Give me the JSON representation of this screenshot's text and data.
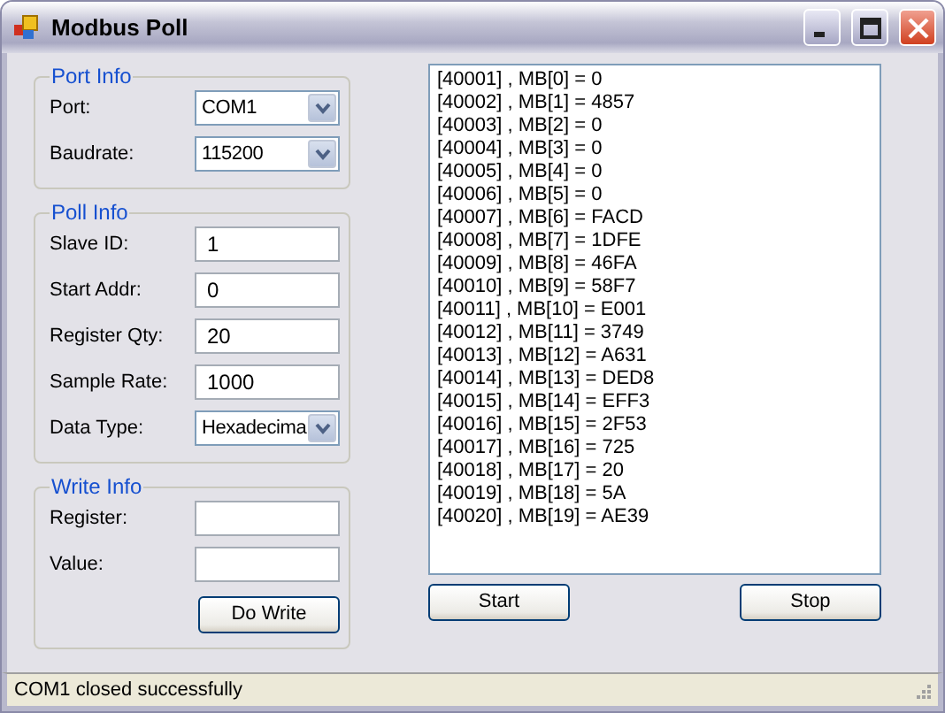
{
  "window": {
    "title": "Modbus Poll"
  },
  "groups": [
    {
      "title": "Port Info",
      "fields": [
        {
          "label": "Port:",
          "kind": "dropdown",
          "value": "COM1"
        },
        {
          "label": "Baudrate:",
          "kind": "dropdown",
          "value": "115200"
        }
      ]
    },
    {
      "title": "Poll Info",
      "fields": [
        {
          "label": "Slave ID:",
          "kind": "text",
          "value": "1"
        },
        {
          "label": "Start Addr:",
          "kind": "text",
          "value": "0"
        },
        {
          "label": "Register Qty:",
          "kind": "text",
          "value": "20"
        },
        {
          "label": "Sample Rate:",
          "kind": "text",
          "value": "1000"
        },
        {
          "label": "Data Type:",
          "kind": "dropdown",
          "value": "Hexadecima"
        }
      ]
    },
    {
      "title": "Write Info",
      "fields": [
        {
          "label": "Register:",
          "kind": "text"
        },
        {
          "label": "Value:",
          "kind": "text"
        }
      ],
      "button": "Do Write"
    }
  ],
  "registers": [
    "[40001] , MB[0] = 0",
    "[40002] , MB[1] = 4857",
    "[40003] , MB[2] = 0",
    "[40004] , MB[3] = 0",
    "[40005] , MB[4] = 0",
    "[40006] , MB[5] = 0",
    "[40007] , MB[6] = FACD",
    "[40008] , MB[7] = 1DFE",
    "[40009] , MB[8] = 46FA",
    "[40010] , MB[9] = 58F7",
    "[40011] , MB[10] = E001",
    "[40012] , MB[11] = 3749",
    "[40013] , MB[12] = A631",
    "[40014] , MB[13] = DED8",
    "[40015] , MB[14] = EFF3",
    "[40016] , MB[15] = 2F53",
    "[40017] , MB[16] = 725",
    "[40018] , MB[17] = 20",
    "[40019] , MB[18] = 5A",
    "[40020] , MB[19] = AE39"
  ],
  "buttons": [
    "Start",
    "Stop"
  ],
  "status_bar": "COM1 closed successfully"
}
